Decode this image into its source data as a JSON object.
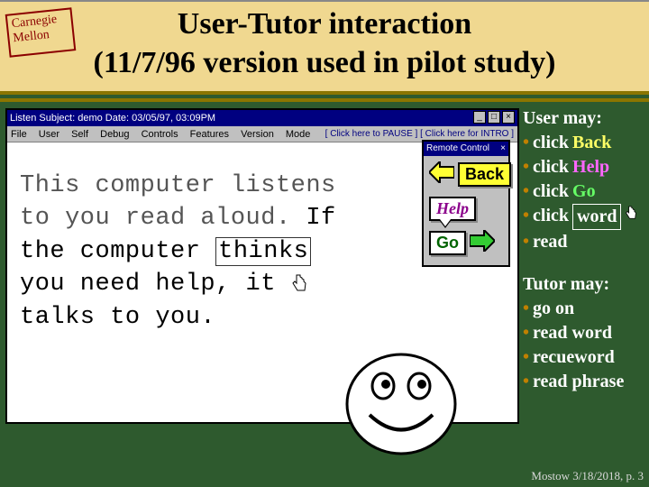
{
  "header": {
    "logo_line1": "Carnegie",
    "logo_line2": "Mellon",
    "title_line1": "User-Tutor interaction",
    "title_line2": "(11/7/96 version used in pilot study)"
  },
  "appwin": {
    "title_text": "Listen    Subject: demo    Date: 03/05/97, 03:09PM",
    "menu_items": [
      "File",
      "User",
      "Self",
      "Debug",
      "Controls",
      "Features",
      "Version",
      "Mode"
    ],
    "menu_right_pause": "[ Click here to PAUSE ]",
    "menu_right_intro": "[ Click here for INTRO ]",
    "reading_w1": "This computer listens",
    "reading_w2": "to you read aloud.",
    "reading_if": "If",
    "reading_w3": "the computer",
    "reading_thinks": "thinks",
    "reading_w4": "you need help, it",
    "reading_w5": "talks to you."
  },
  "remote": {
    "title": "Remote Control",
    "back_label": "Back",
    "help_label": "Help",
    "go_label": "Go"
  },
  "right": {
    "user_heading": "User may:",
    "b1_pre": "click",
    "b1_word": "Back",
    "b2_pre": "click",
    "b2_word": "Help",
    "b3_pre": "click",
    "b3_word": "Go",
    "b4_pre": "click",
    "b4_word": "word",
    "b5": "read",
    "tutor_heading": "Tutor may:",
    "t1": "go on",
    "t2": "read word",
    "t3": "recueword",
    "t4": "read phrase"
  },
  "footer": {
    "text": "Mostow 3/18/2018, p. 3"
  }
}
